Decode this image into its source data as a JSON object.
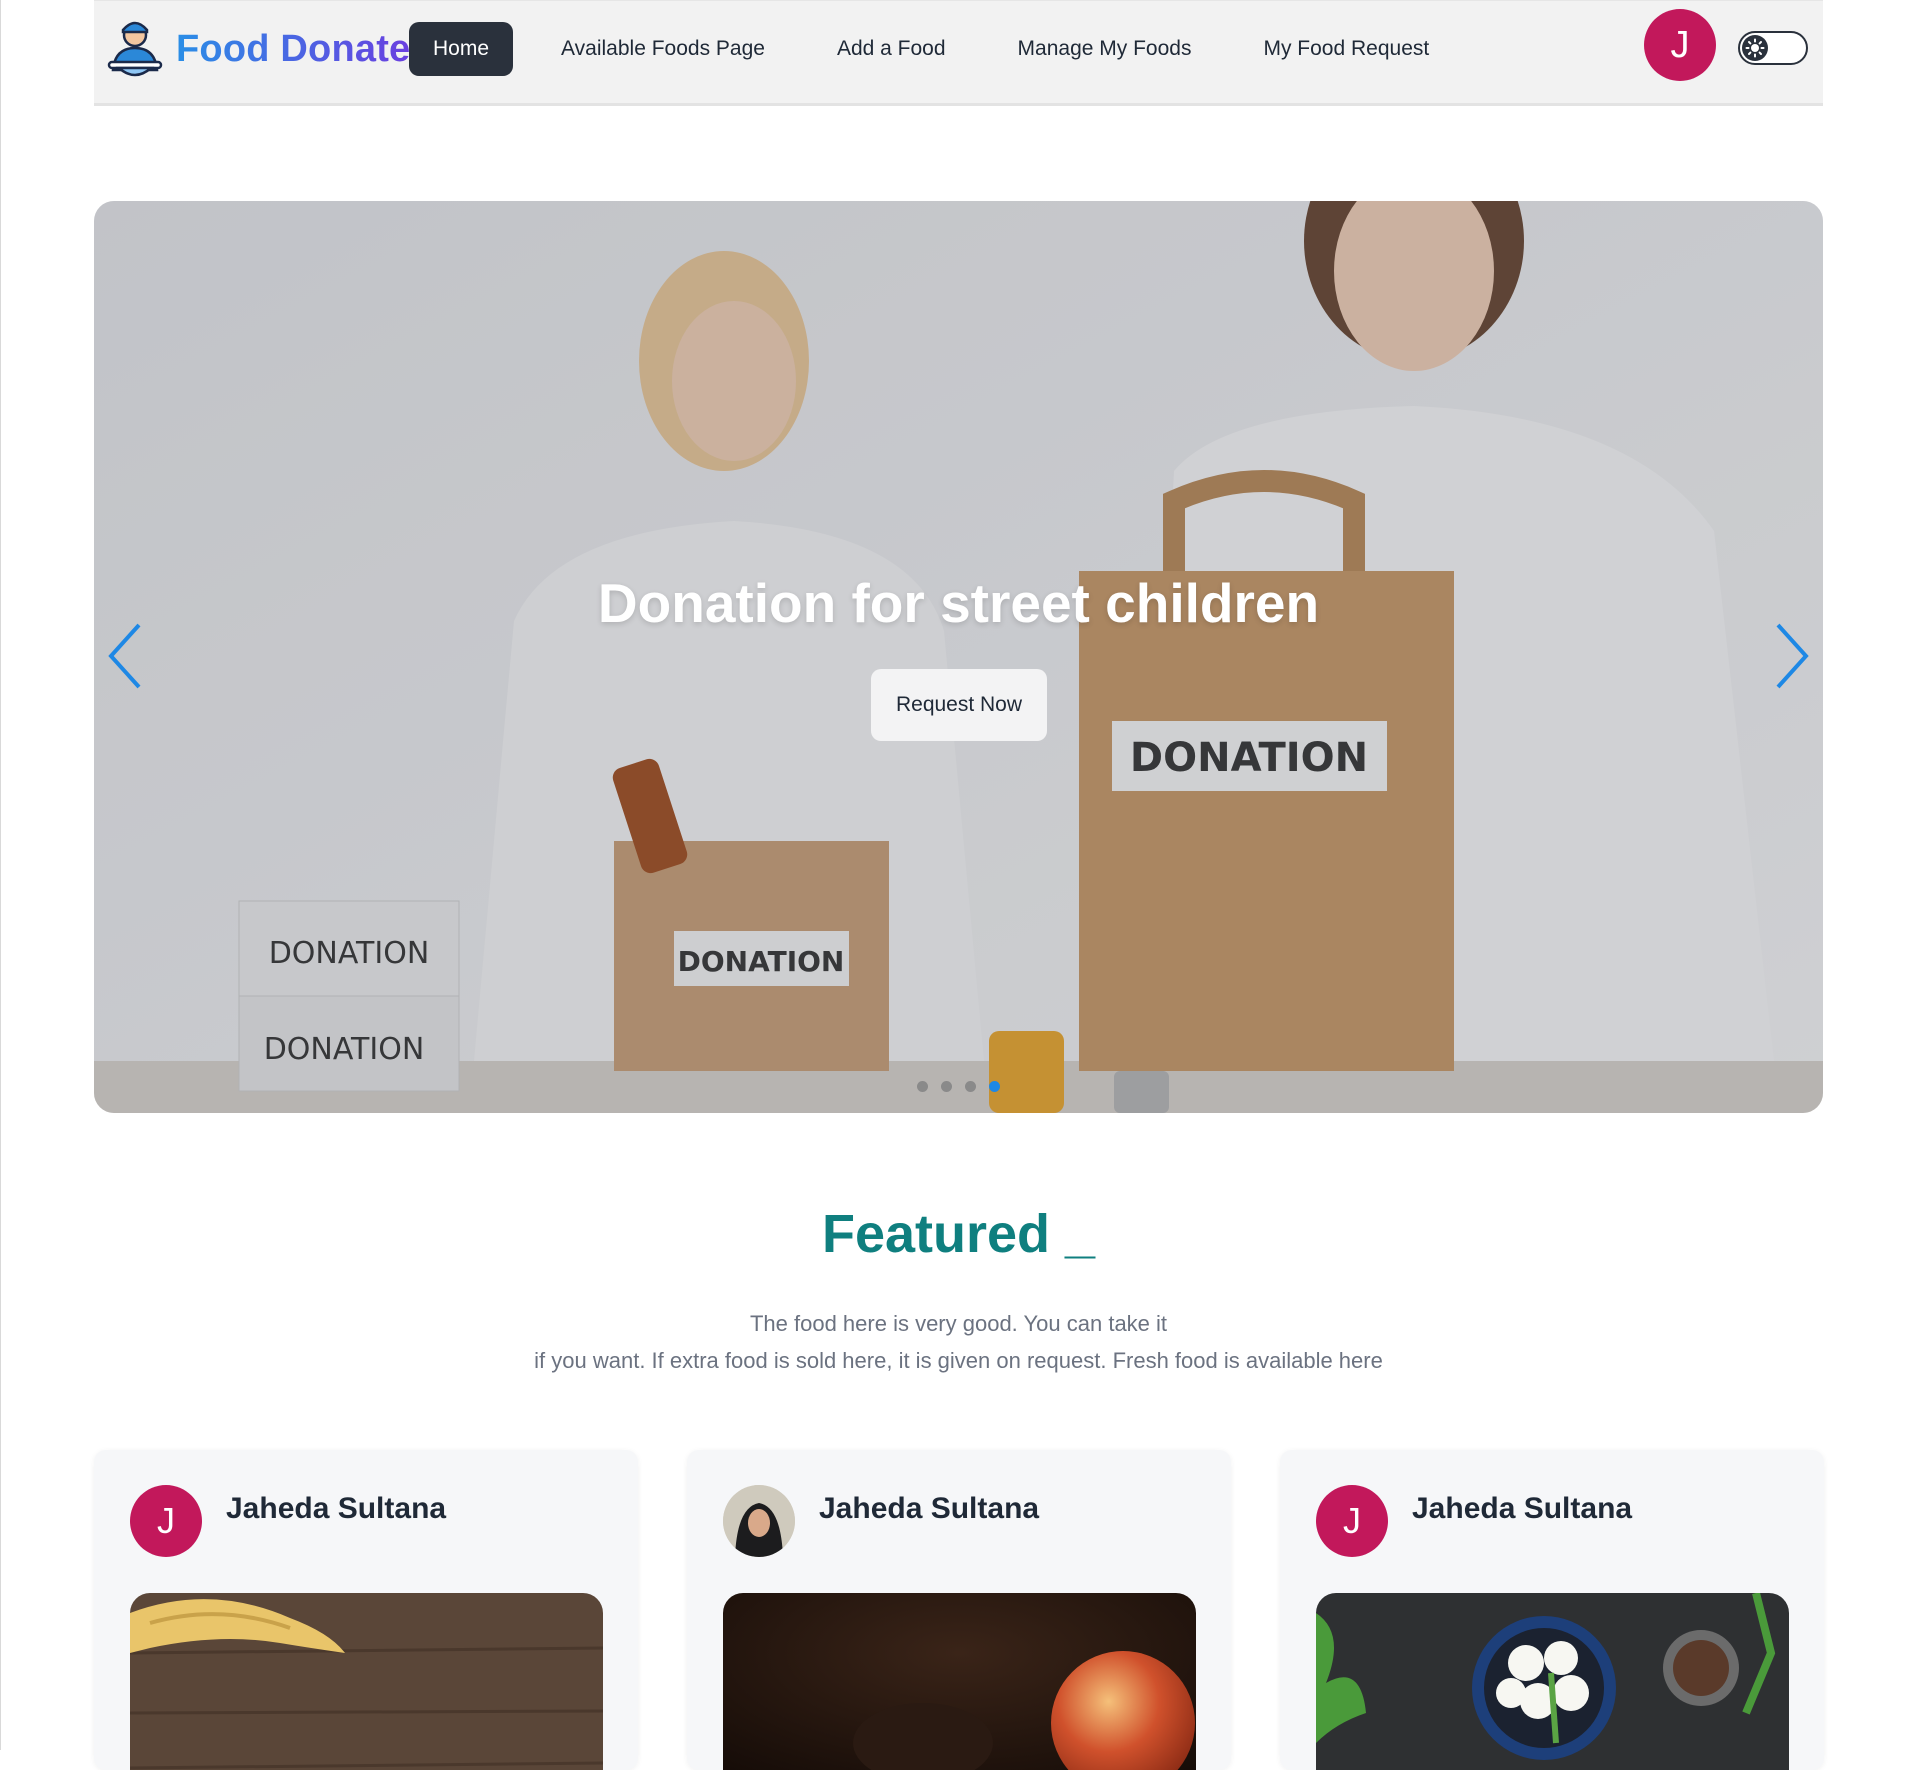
{
  "brand": {
    "name": "Food Donate",
    "logo_icon": "delivery-person-icon"
  },
  "nav": {
    "links": [
      "Home",
      "Available Foods Page",
      "Add a Food",
      "Manage My Foods",
      "My Food Request"
    ],
    "active_index": 0,
    "avatar_initial": "J",
    "theme_toggle_icon": "sun-icon"
  },
  "hero": {
    "title": "Donation for street children",
    "button": "Request Now",
    "slide_count": 4,
    "active_slide": 4,
    "labels": [
      "DONATION",
      "DONATION",
      "DONATION",
      "DONATION"
    ]
  },
  "featured": {
    "title": "Featured _",
    "subtitle_line1": "The food here is very good. You can take it",
    "subtitle_line2": "if you want. If extra food is sold here, it is given on request. Fresh food is available here"
  },
  "cards": [
    {
      "donor_name": "Jaheda Sultana",
      "avatar_initial": "J",
      "avatar_type": "initial"
    },
    {
      "donor_name": "Jaheda Sultana",
      "avatar_initial": "",
      "avatar_type": "photo"
    },
    {
      "donor_name": "Jaheda Sultana",
      "avatar_initial": "J",
      "avatar_type": "initial"
    }
  ],
  "colors": {
    "accent_dark": "#2a313c",
    "avatar": "#c2185b",
    "featured_title": "#0f7f7f",
    "carousel_arrow": "#1e88e5"
  }
}
